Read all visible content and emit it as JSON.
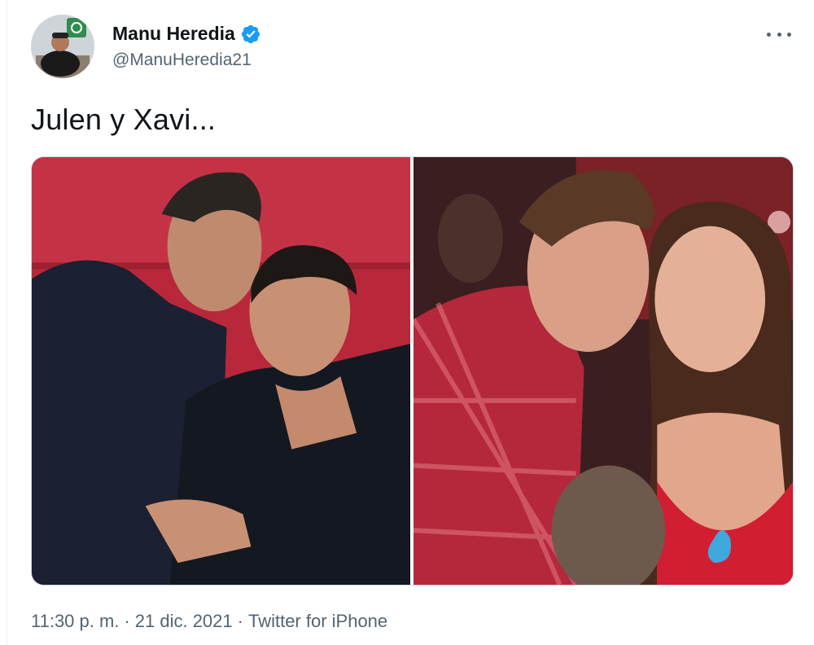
{
  "author": {
    "display_name": "Manu Heredia",
    "handle": "@ManuHeredia21",
    "verified": true
  },
  "tweet": {
    "text": "Julen y Xavi..."
  },
  "media": {
    "photos": [
      {
        "description_icon": "photo-icon"
      },
      {
        "description_icon": "photo-icon"
      }
    ]
  },
  "meta": {
    "time": "11:30 p. m.",
    "separator": "·",
    "date": "21 dic. 2021",
    "source": "Twitter for iPhone"
  },
  "colors": {
    "verified_blue": "#1d9bf0",
    "text_primary": "#0f1419",
    "text_secondary": "#536471",
    "border": "#cfd9de"
  }
}
